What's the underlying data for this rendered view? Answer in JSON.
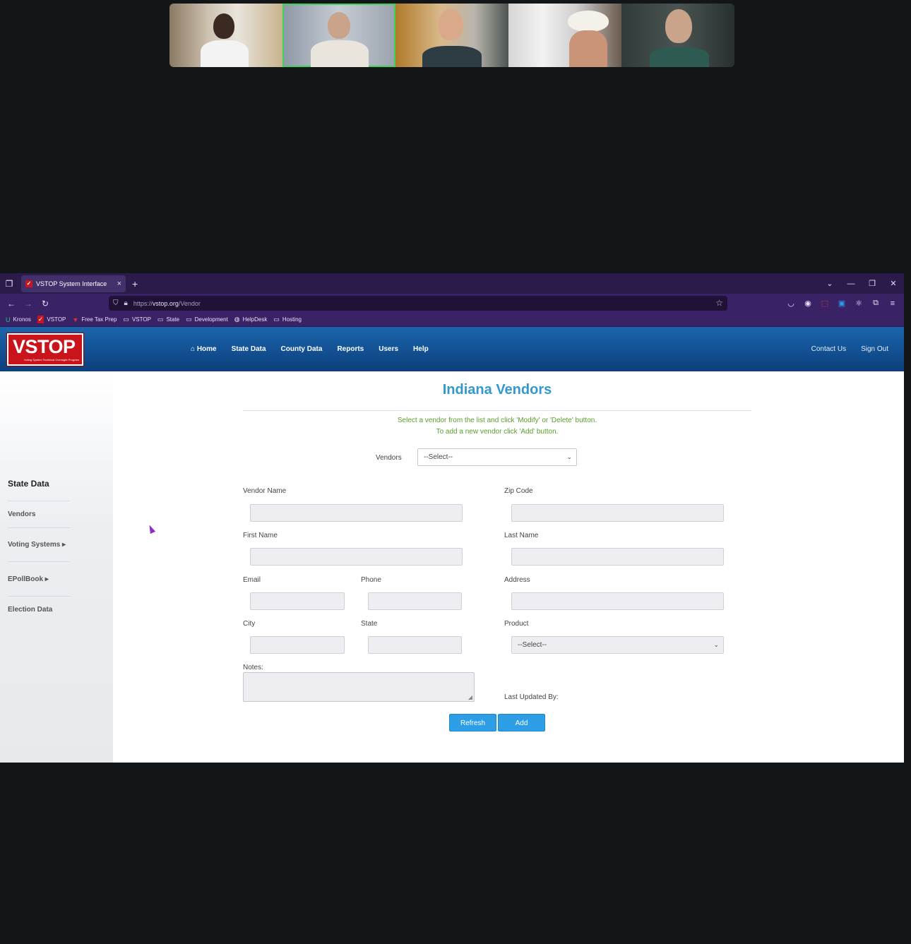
{
  "video_call": {
    "participants": [
      {
        "name": "participant-1",
        "active": false
      },
      {
        "name": "participant-2",
        "active": true
      },
      {
        "name": "participant-3",
        "active": false
      },
      {
        "name": "participant-4",
        "active": false
      },
      {
        "name": "participant-5",
        "active": false
      }
    ],
    "active_color": "#3dd35a"
  },
  "browser": {
    "tab_title": "VSTOP System Interface",
    "tab_close": "×",
    "new_tab": "+",
    "url_prefix": "https://",
    "url_host": "vstop.org",
    "url_path": "/Vendor",
    "bookmarks": [
      {
        "label": "Kronos",
        "icon": "kronos-icon"
      },
      {
        "label": "VSTOP",
        "icon": "vstop-icon"
      },
      {
        "label": "Free Tax Prep",
        "icon": "tax-icon"
      },
      {
        "label": "VSTOP",
        "icon": "folder-icon"
      },
      {
        "label": "State",
        "icon": "folder-icon"
      },
      {
        "label": "Development",
        "icon": "folder-icon"
      },
      {
        "label": "HelpDesk",
        "icon": "globe-icon"
      },
      {
        "label": "Hosting",
        "icon": "folder-icon"
      }
    ],
    "theme_color": "#3a2266"
  },
  "site": {
    "logo_text": "VSTOP",
    "logo_subtitle": "Voting System Technical Oversight Program",
    "nav": [
      "Home",
      "State Data",
      "County Data",
      "Reports",
      "Users",
      "Help"
    ],
    "right_nav": [
      "Contact Us",
      "Sign Out"
    ],
    "header_color": "#1a65ad"
  },
  "sidebar": {
    "title": "State Data",
    "items": [
      "Vendors",
      "Voting Systems ▸",
      "EPollBook ▸",
      "Election Data"
    ]
  },
  "main": {
    "title": "Indiana Vendors",
    "instructions": [
      "Select a vendor from the list and click 'Modify' or 'Delete' button.",
      "To add a new vendor click 'Add' button."
    ],
    "vendors_label": "Vendors",
    "vendors_selected": "--Select--",
    "fields": {
      "vendor_name": "Vendor Name",
      "zip_code": "Zip Code",
      "first_name": "First Name",
      "last_name": "Last Name",
      "email": "Email",
      "phone": "Phone",
      "address": "Address",
      "city": "City",
      "state": "State",
      "product": "Product",
      "notes": "Notes:",
      "last_updated_by": "Last Updated By:"
    },
    "product_selected": "--Select--",
    "buttons": {
      "refresh": "Refresh",
      "add": "Add"
    },
    "accent_color": "#3399cc",
    "instruction_color": "#5a9e2c",
    "button_color": "#2d9ee6"
  }
}
